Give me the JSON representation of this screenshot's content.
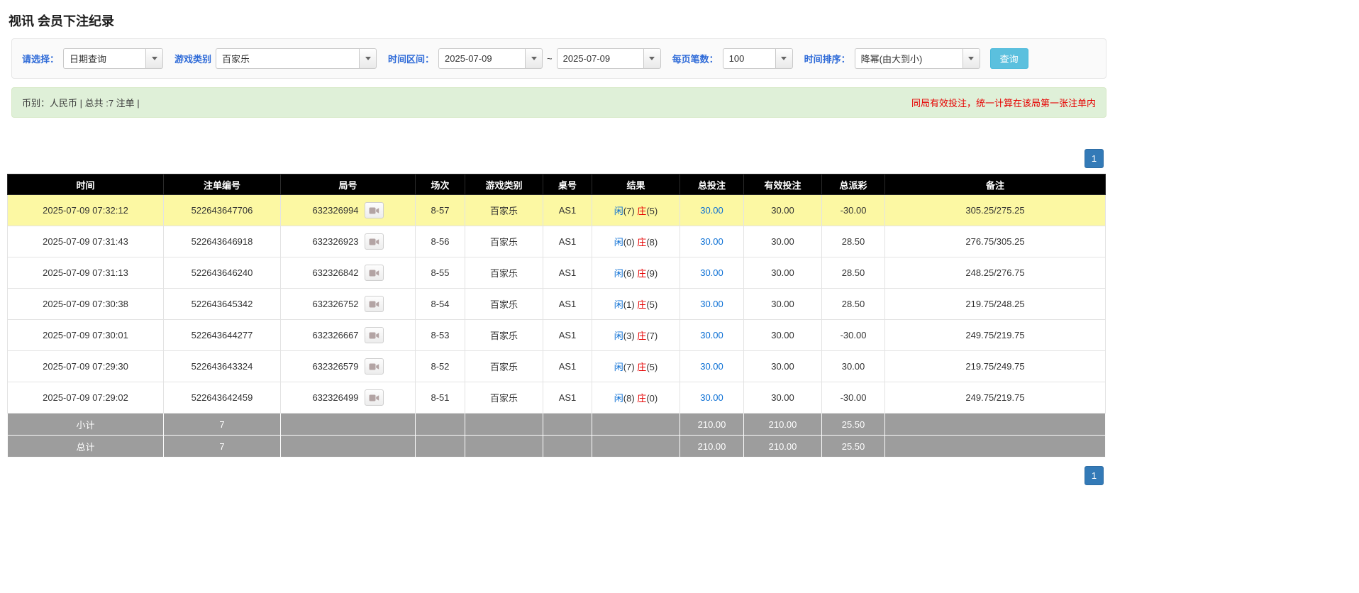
{
  "page_title": "视讯 会员下注纪录",
  "filters": {
    "select_label": "请选择：",
    "select_value": "日期查询",
    "game_label": "游戏类别",
    "game_value": "百家乐",
    "range_label": "时间区间：",
    "date_from": "2025-07-09",
    "range_separator": "~",
    "date_to": "2025-07-09",
    "page_size_label": "每页笔数：",
    "page_size_value": "100",
    "sort_label": "时间排序：",
    "sort_value": "降幂(由大到小)",
    "search_label": "查询"
  },
  "summary_bar": {
    "left_text": "币别：人民币 | 总共 :7 注单 |",
    "right_notice": "同局有效投注，统一计算在该局第一张注单内"
  },
  "pagination": {
    "current_page": "1"
  },
  "icons": {
    "round_icon": "video-replay-icon",
    "combo_button_icon": "caret-down-icon"
  },
  "colors": {
    "header_bg": "#000000",
    "highlight_row": "#fcf8a3",
    "link_blue": "#0b6fd4",
    "player_blue": "#0b6fd4",
    "banker_red": "#e60000",
    "negative_red": "#e60000",
    "notice_red": "#e60000",
    "search_button_blue": "#5bc0de",
    "pagination_blue": "#337ab7",
    "summary_row_gray": "#9d9d9d",
    "green_bar_bg": "#dff0d8",
    "label_blue": "#2f6bd8"
  },
  "table": {
    "headers": [
      "时间",
      "注单编号",
      "局号",
      "场次",
      "游戏类别",
      "桌号",
      "结果",
      "总投注",
      "有效投注",
      "总派彩",
      "备注"
    ],
    "rows": [
      {
        "time": "2025-07-09 07:32:12",
        "bet_id": "522643647706",
        "round_id": "632326994",
        "session": "8-57",
        "game": "百家乐",
        "table_no": "AS1",
        "result": {
          "player": "闲",
          "player_score": "7",
          "banker": "庄",
          "banker_score": "5"
        },
        "total_bet": "30.00",
        "valid_bet": "30.00",
        "payout": "-30.00",
        "remark": "305.25/275.25",
        "highlight": true
      },
      {
        "time": "2025-07-09 07:31:43",
        "bet_id": "522643646918",
        "round_id": "632326923",
        "session": "8-56",
        "game": "百家乐",
        "table_no": "AS1",
        "result": {
          "player": "闲",
          "player_score": "0",
          "banker": "庄",
          "banker_score": "8"
        },
        "total_bet": "30.00",
        "valid_bet": "30.00",
        "payout": "28.50",
        "remark": "276.75/305.25",
        "highlight": false
      },
      {
        "time": "2025-07-09 07:31:13",
        "bet_id": "522643646240",
        "round_id": "632326842",
        "session": "8-55",
        "game": "百家乐",
        "table_no": "AS1",
        "result": {
          "player": "闲",
          "player_score": "6",
          "banker": "庄",
          "banker_score": "9"
        },
        "total_bet": "30.00",
        "valid_bet": "30.00",
        "payout": "28.50",
        "remark": "248.25/276.75",
        "highlight": false
      },
      {
        "time": "2025-07-09 07:30:38",
        "bet_id": "522643645342",
        "round_id": "632326752",
        "session": "8-54",
        "game": "百家乐",
        "table_no": "AS1",
        "result": {
          "player": "闲",
          "player_score": "1",
          "banker": "庄",
          "banker_score": "5"
        },
        "total_bet": "30.00",
        "valid_bet": "30.00",
        "payout": "28.50",
        "remark": "219.75/248.25",
        "highlight": false
      },
      {
        "time": "2025-07-09 07:30:01",
        "bet_id": "522643644277",
        "round_id": "632326667",
        "session": "8-53",
        "game": "百家乐",
        "table_no": "AS1",
        "result": {
          "player": "闲",
          "player_score": "3",
          "banker": "庄",
          "banker_score": "7"
        },
        "total_bet": "30.00",
        "valid_bet": "30.00",
        "payout": "-30.00",
        "remark": "249.75/219.75",
        "highlight": false
      },
      {
        "time": "2025-07-09 07:29:30",
        "bet_id": "522643643324",
        "round_id": "632326579",
        "session": "8-52",
        "game": "百家乐",
        "table_no": "AS1",
        "result": {
          "player": "闲",
          "player_score": "7",
          "banker": "庄",
          "banker_score": "5"
        },
        "total_bet": "30.00",
        "valid_bet": "30.00",
        "payout": "30.00",
        "remark": "219.75/249.75",
        "highlight": false
      },
      {
        "time": "2025-07-09 07:29:02",
        "bet_id": "522643642459",
        "round_id": "632326499",
        "session": "8-51",
        "game": "百家乐",
        "table_no": "AS1",
        "result": {
          "player": "闲",
          "player_score": "8",
          "banker": "庄",
          "banker_score": "0"
        },
        "total_bet": "30.00",
        "valid_bet": "30.00",
        "payout": "-30.00",
        "remark": "249.75/219.75",
        "highlight": false
      }
    ],
    "subtotal": {
      "label": "小计",
      "count": "7",
      "total_bet": "210.00",
      "valid_bet": "210.00",
      "payout": "25.50"
    },
    "grand_total": {
      "label": "总计",
      "count": "7",
      "total_bet": "210.00",
      "valid_bet": "210.00",
      "payout": "25.50"
    }
  }
}
